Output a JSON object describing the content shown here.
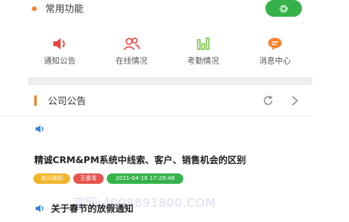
{
  "common": {
    "title": "常用功能",
    "items": [
      {
        "label": "通知公告",
        "icon": "speaker-icon",
        "color": "#e8453c"
      },
      {
        "label": "在线情况",
        "icon": "users-icon",
        "color": "#e8453c"
      },
      {
        "label": "考勤情况",
        "icon": "bar-chart-icon",
        "color": "#7cc04b"
      },
      {
        "label": "消息中心",
        "icon": "message-icon",
        "color": "#f5822a"
      }
    ]
  },
  "notice": {
    "title": "公司公告",
    "items": [
      {
        "title": "精诚CRM&PM系统中线索、客户、销售机会的区别",
        "tags": [
          "培训通知",
          "王俊青",
          "2021-04-16 17:29:48"
        ]
      },
      {
        "title": "关于春节的放假通知"
      }
    ]
  },
  "watermark": "宫网:4008891800.COM",
  "colors": {
    "accent_green": "#35b24a",
    "accent_orange": "#f5822a",
    "red": "#e8453c"
  }
}
